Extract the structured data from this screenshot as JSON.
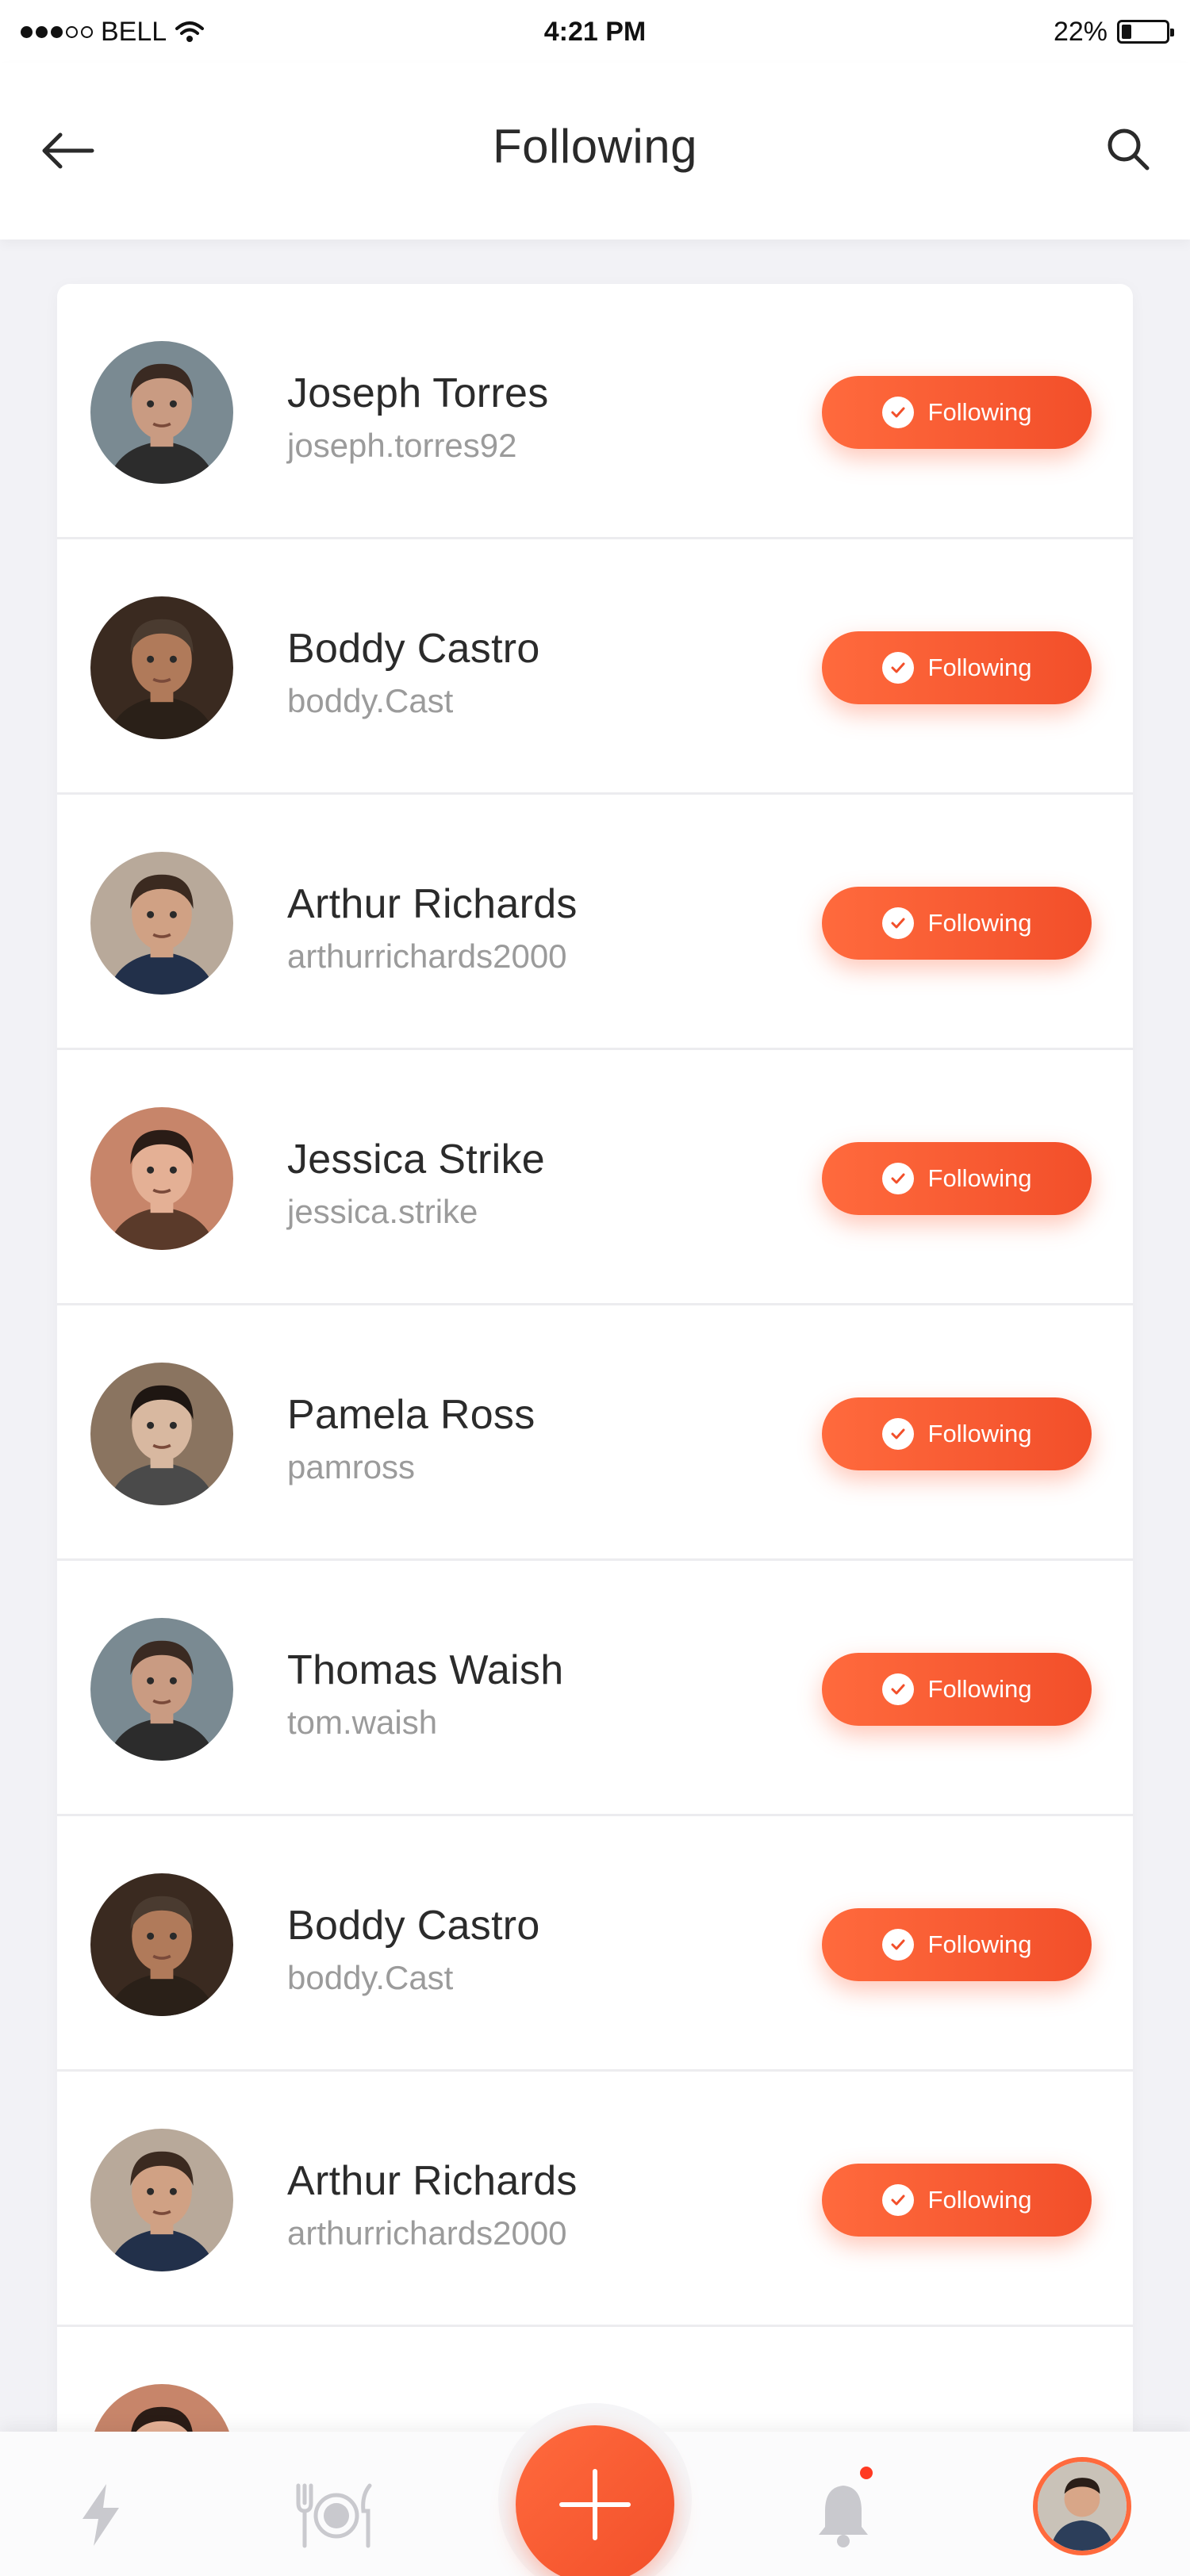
{
  "status_bar": {
    "carrier": "BELL",
    "time": "4:21 PM",
    "battery": "22%",
    "battery_level": 0.22
  },
  "header": {
    "title": "Following",
    "back_icon": "arrow-left-icon",
    "search_icon": "search-icon"
  },
  "users": [
    {
      "name": "Joseph Torres",
      "handle": "joseph.torres92",
      "button": "Following",
      "avatar": "man-dark-hair"
    },
    {
      "name": "Boddy Castro",
      "handle": "boddy.Cast",
      "button": "Following",
      "avatar": "older-man"
    },
    {
      "name": "Arthur Richards",
      "handle": "arthurrichards2000",
      "button": "Following",
      "avatar": "man-suit"
    },
    {
      "name": "Jessica Strike",
      "handle": "jessica.strike",
      "button": "Following",
      "avatar": "woman-light"
    },
    {
      "name": "Pamela Ross",
      "handle": "pamross",
      "button": "Following",
      "avatar": "woman-dark-hair"
    },
    {
      "name": "Thomas Waish",
      "handle": "tom.waish",
      "button": "Following",
      "avatar": "man-dark-hair"
    },
    {
      "name": "Boddy Castro",
      "handle": "boddy.Cast",
      "button": "Following",
      "avatar": "older-man"
    },
    {
      "name": "Arthur Richards",
      "handle": "arthurrichards2000",
      "button": "Following",
      "avatar": "man-suit"
    }
  ],
  "tab_bar": {
    "items": [
      "lightning-icon",
      "dining-icon",
      "plus-icon",
      "bell-icon",
      "profile-avatar"
    ],
    "accent": "#ff6a3d"
  },
  "colors": {
    "accent": "#ff6a3d",
    "accent_dark": "#f24f2a",
    "muted_text": "#9b9b9b"
  }
}
